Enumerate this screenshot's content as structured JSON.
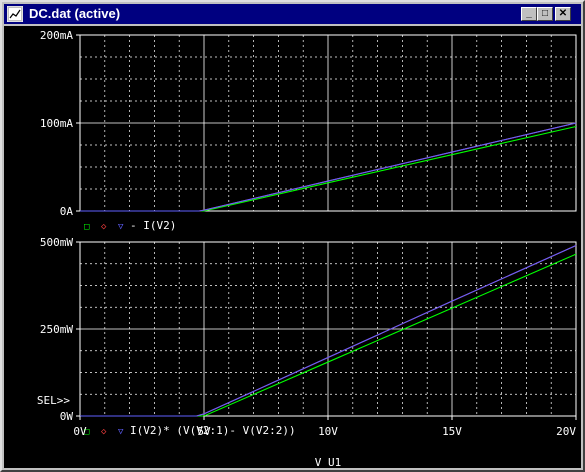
{
  "window": {
    "title": "DC.dat (active)",
    "buttons": {
      "minimize": "_",
      "maximize": "□",
      "close": "✕"
    }
  },
  "colors": {
    "background": "#000000",
    "axis": "#ffffff",
    "grid": "#ffffff",
    "trace_green": "#00ff00",
    "trace_red": "#ff4040",
    "trace_blue": "#6060ff",
    "title_bar": "#000080"
  },
  "chart_data": [
    {
      "type": "line",
      "ylabel_ticks": [
        "0A",
        "100mA",
        "200mA"
      ],
      "ylim": [
        0,
        0.2
      ],
      "xlim": [
        0,
        20
      ],
      "grid": true,
      "legend_markers": [
        "□",
        "◇",
        "▽"
      ],
      "legend_text": "- I(V2)",
      "series": [
        {
          "color": "green",
          "x": [
            0,
            4.9,
            5,
            10,
            15,
            20
          ],
          "y": [
            0,
            0,
            0.0,
            0.032,
            0.064,
            0.096
          ]
        },
        {
          "color": "red",
          "x": [
            0,
            4.8,
            5,
            10,
            15,
            20
          ],
          "y": [
            0,
            0,
            0.001,
            0.034,
            0.067,
            0.1
          ]
        },
        {
          "color": "blue",
          "x": [
            0,
            4.8,
            5,
            10,
            15,
            20
          ],
          "y": [
            0,
            0,
            0.001,
            0.034,
            0.067,
            0.1
          ]
        }
      ]
    },
    {
      "type": "line",
      "ylabel_ticks": [
        "0W",
        "250mW",
        "500mW"
      ],
      "ylim": [
        0,
        0.5
      ],
      "xlim": [
        0,
        20
      ],
      "xticks": [
        "0V",
        "5V",
        "10V",
        "15V",
        "20V"
      ],
      "xlabel": "V_U1",
      "grid": true,
      "sel_marker": "SEL>>",
      "legend_markers": [
        "□",
        "◇",
        "▽"
      ],
      "legend_text": "I(V2)* (V(V2:1)- V(V2:2))",
      "series": [
        {
          "color": "green",
          "x": [
            0,
            4.9,
            5,
            10,
            15,
            20
          ],
          "y": [
            0,
            0,
            0.0,
            0.155,
            0.31,
            0.465
          ]
        },
        {
          "color": "red",
          "x": [
            0,
            4.7,
            5,
            10,
            15,
            20
          ],
          "y": [
            0,
            0,
            0.006,
            0.168,
            0.33,
            0.49
          ]
        },
        {
          "color": "blue",
          "x": [
            0,
            4.7,
            5,
            10,
            15,
            20
          ],
          "y": [
            0,
            0,
            0.006,
            0.168,
            0.33,
            0.49
          ]
        }
      ]
    }
  ]
}
